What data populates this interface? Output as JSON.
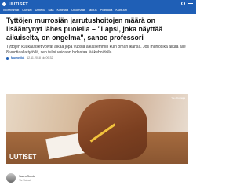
{
  "header": {
    "logo": "UUTISET",
    "nav": [
      "Tuoreimmat",
      "Uutiset",
      "Urheilu",
      "Sää",
      "Kotimaa",
      "Ulkomaat",
      "Talous",
      "Politiikka",
      "Kulttuuri"
    ]
  },
  "article": {
    "headline": "Tyttöjen murrosiän jarrutushoitojen määrä on lisääntynyt lähes puolella – \"Lapsi, joka näyttää aikuiselta, on ongelma\", sanoo professori",
    "lead": "Tyttöjen kuukautiset voivat alkaa jopa vuosia aikaisemmin kuin oman ikänsä. Jos murrosikä alkaa alle 8-vuotiaalla tytöllä, sen tulisi voidaan hidastaa lääkehoidolla.",
    "category": "Murrosikä",
    "timestamp": "12.11.2018 klo 09:32"
  },
  "photo": {
    "credit": "Yle / Kuvaaja",
    "brand": "UUTISET"
  },
  "author": {
    "name": "Saara Sonda",
    "role": "Yle Uutiset"
  },
  "colors": {
    "brand": "#1f5fb6"
  }
}
